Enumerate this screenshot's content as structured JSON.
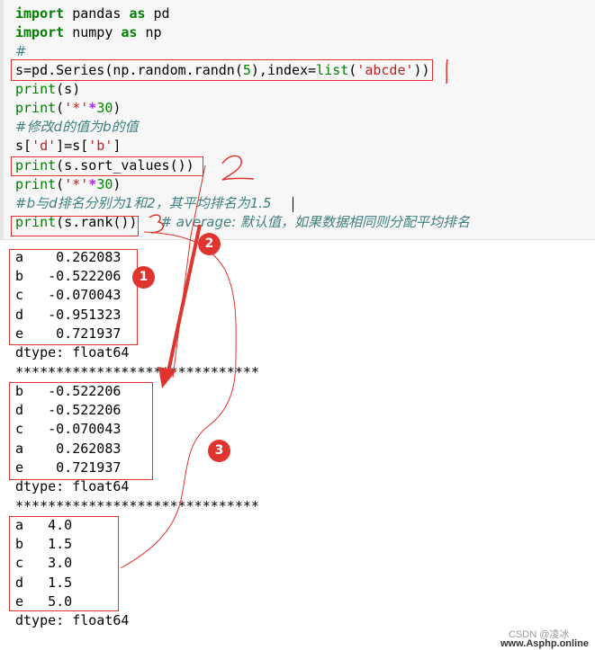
{
  "code": {
    "l1_kw1": "import",
    "l1_mod": " pandas ",
    "l1_kw2": "as",
    "l1_alias": " pd",
    "l2_kw1": "import",
    "l2_mod": " numpy ",
    "l2_kw2": "as",
    "l2_alias": " np",
    "l3": "#",
    "l4_a": "s=pd.Series(np.random.randn(",
    "l4_num": "5",
    "l4_b": "),index=",
    "l4_fn": "list",
    "l4_c": "(",
    "l4_str": "'abcde'",
    "l4_d": "))",
    "l5_fn": "print",
    "l5_rest": "(s)",
    "l6_fn": "print",
    "l6_a": "(",
    "l6_str": "'*'",
    "l6_op": "*",
    "l6_num": "30",
    "l6_b": ")",
    "l7": "#修改d的值为b的值",
    "l8_a": "s[",
    "l8_str1": "'d'",
    "l8_b": "]=s[",
    "l8_str2": "'b'",
    "l8_c": "]",
    "l9_fn": "print",
    "l9_rest": "(s.sort_values())",
    "l10_fn": "print",
    "l10_a": "(",
    "l10_str": "'*'",
    "l10_op": "*",
    "l10_num": "30",
    "l10_b": ")",
    "l11": "#b与d排名分别为1和2，其平均排名为1.5",
    "l12_fn": "print",
    "l12_rest": "(s.rank())",
    "l12_comment": "# average: 默认值，如果数据相同则分配平均排名"
  },
  "output": {
    "block1": [
      {
        "idx": "a",
        "val": " 0.262083"
      },
      {
        "idx": "b",
        "val": "-0.522206"
      },
      {
        "idx": "c",
        "val": "-0.070043"
      },
      {
        "idx": "d",
        "val": "-0.951323"
      },
      {
        "idx": "e",
        "val": " 0.721937"
      }
    ],
    "dtype1": "dtype: float64",
    "sep1": "******************************",
    "block2": [
      {
        "idx": "b",
        "val": "-0.522206"
      },
      {
        "idx": "d",
        "val": "-0.522206"
      },
      {
        "idx": "c",
        "val": "-0.070043"
      },
      {
        "idx": "a",
        "val": " 0.262083"
      },
      {
        "idx": "e",
        "val": " 0.721937"
      }
    ],
    "dtype2": "dtype: float64",
    "sep2": "******************************",
    "block3": [
      {
        "idx": "a",
        "val": "4.0"
      },
      {
        "idx": "b",
        "val": "1.5"
      },
      {
        "idx": "c",
        "val": "3.0"
      },
      {
        "idx": "d",
        "val": "1.5"
      },
      {
        "idx": "e",
        "val": "5.0"
      }
    ],
    "dtype3": "dtype: float64"
  },
  "annotations": {
    "badge1": "1",
    "badge2": "2",
    "badge3": "3",
    "accent_color": "#e0342f"
  },
  "watermark": {
    "csdn": "CSDN @凌冰",
    "site": "www.Asphp.online"
  }
}
